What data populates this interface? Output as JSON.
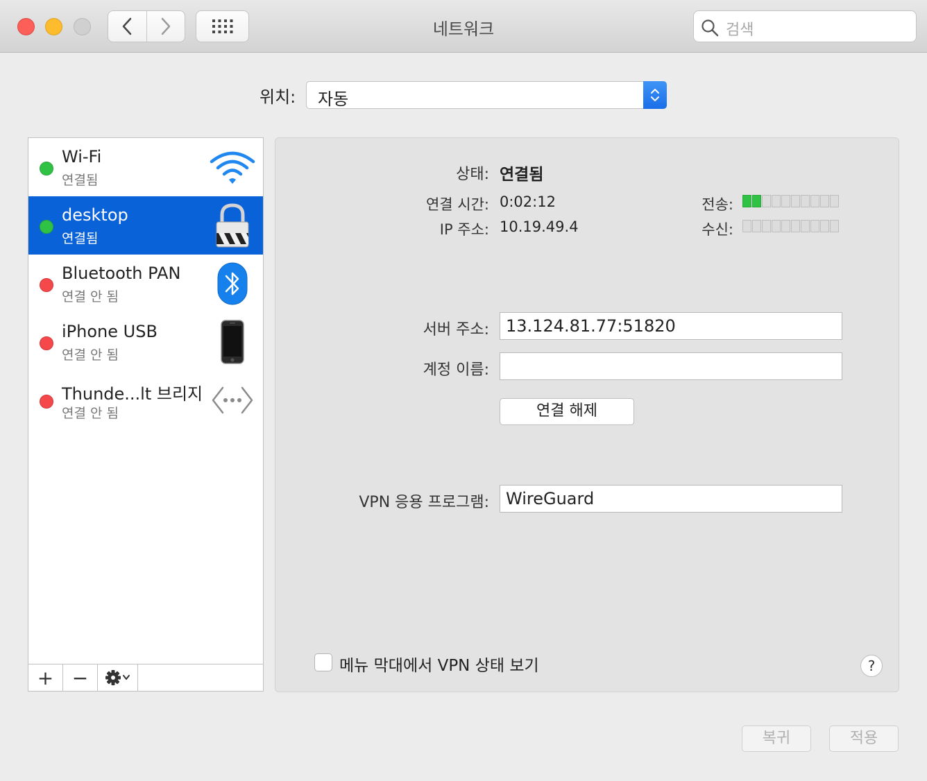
{
  "window": {
    "title": "네트워크"
  },
  "search": {
    "placeholder": "검색"
  },
  "location": {
    "label": "위치:",
    "value": "자동"
  },
  "services": [
    {
      "name": "Wi-Fi",
      "status": "연결됨",
      "status_color": "#2fc244",
      "icon": "wifi-icon",
      "selected": false
    },
    {
      "name": "desktop",
      "status": "연결됨",
      "status_color": "#2fc244",
      "icon": "lock-icon",
      "selected": true
    },
    {
      "name": "Bluetooth PAN",
      "status": "연결 안 됨",
      "status_color": "#f4484a",
      "icon": "bluetooth-icon",
      "selected": false
    },
    {
      "name": "iPhone USB",
      "status": "연결 안 됨",
      "status_color": "#f4484a",
      "icon": "iphone-icon",
      "selected": false
    },
    {
      "name": "Thunde...lt 브리지",
      "status": "연결 안 됨",
      "status_color": "#f4484a",
      "icon": "bridge-icon",
      "selected": false
    }
  ],
  "sidebar_toolbar": {
    "add": "+",
    "remove": "−"
  },
  "detail": {
    "status_label": "상태:",
    "status_value": "연결됨",
    "connect_time_label": "연결 시간:",
    "connect_time_value": "0:02:12",
    "ip_label": "IP 주소:",
    "ip_value": "10.19.49.4",
    "send_label": "전송:",
    "send_level": 2,
    "receive_label": "수신:",
    "receive_level": 0,
    "meter_segments": 10,
    "server_label": "서버 주소:",
    "server_value": "13.124.81.77:51820",
    "account_label": "계정 이름:",
    "account_value": "",
    "disconnect_button": "연결 해제",
    "vpn_app_label": "VPN 응용 프로그램:",
    "vpn_app_value": "WireGuard",
    "show_status_checkbox": "메뉴 막대에서 VPN 상태 보기",
    "show_status_checked": false,
    "help": "?"
  },
  "footer": {
    "revert": "복귀",
    "apply": "적용"
  },
  "colors": {
    "accent": "#0a62d8",
    "connected": "#2fc244",
    "disconnected": "#f4484a"
  }
}
